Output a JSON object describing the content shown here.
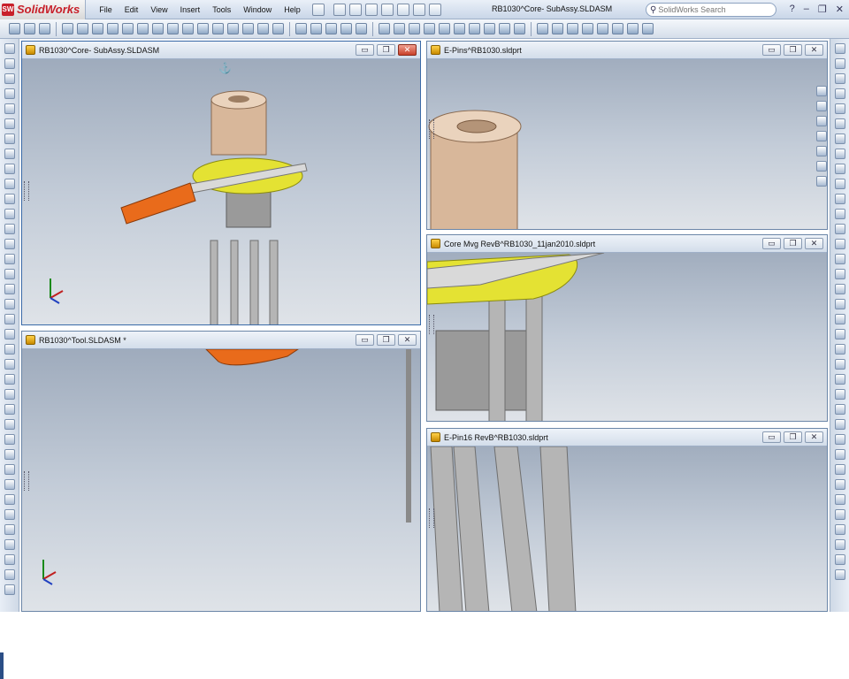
{
  "app": {
    "name": "SolidWorks",
    "title": "RB1030^Core- SubAssy.SLDASM"
  },
  "menu": [
    "File",
    "Edit",
    "View",
    "Insert",
    "Tools",
    "Window",
    "Help"
  ],
  "search": {
    "placeholder": "SolidWorks Search"
  },
  "window_controls": [
    "?",
    "–",
    "❐",
    "✕"
  ],
  "viewports": [
    {
      "title": "RB1030^Core- SubAssy.SLDASM",
      "active": true
    },
    {
      "title": "E-Pins^RB1030.sldprt",
      "active": false
    },
    {
      "title": "Core Mvg RevB^RB1030_11jan2010.sldprt",
      "active": false
    },
    {
      "title": "RB1030^Tool.SLDASM *",
      "active": false
    },
    {
      "title": "E-Pin16 RevB^RB1030.sldprt",
      "active": false
    }
  ],
  "viewport_controls": {
    "minimize": "▭",
    "restore": "❐",
    "close": "✕"
  },
  "colors": {
    "accent": "#c8202a",
    "viewport_bg_top": "#9aa7b9",
    "viewport_bg_bottom": "#dfe3e8",
    "core_tan": "#d8b79a",
    "yellow_part": "#e4e233",
    "pin_grey": "#b7b7b7",
    "orange_part": "#e96b1b"
  }
}
